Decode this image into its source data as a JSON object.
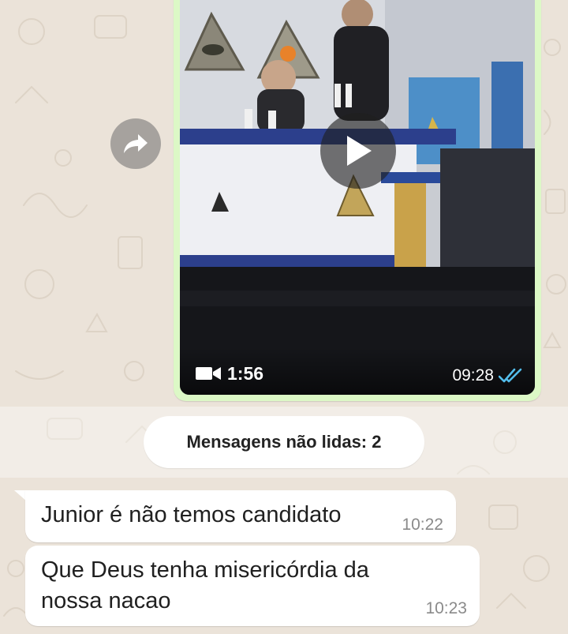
{
  "chat": {
    "video_message": {
      "duration": "1:56",
      "time": "09:28",
      "status": "read",
      "tick_color": "#53bdeb",
      "bubble_color": "#dcf8c6"
    },
    "unread_divider": {
      "label": "Mensagens não lidas: 2"
    },
    "messages": [
      {
        "text": "Junior é não temos candidato",
        "time": "10:22"
      },
      {
        "text": "Que Deus tenha misericórdia da\nnossa nacao",
        "time": "10:23"
      }
    ]
  },
  "icons": {
    "forward": "forward-arrow-icon",
    "play": "play-icon",
    "video": "video-camera-icon",
    "ticks": "double-check-icon"
  },
  "colors": {
    "chat_background": "#ebe3d9",
    "incoming_bubble": "#ffffff",
    "outgoing_bubble": "#dcf8c6",
    "read_ticks": "#53bdeb"
  }
}
